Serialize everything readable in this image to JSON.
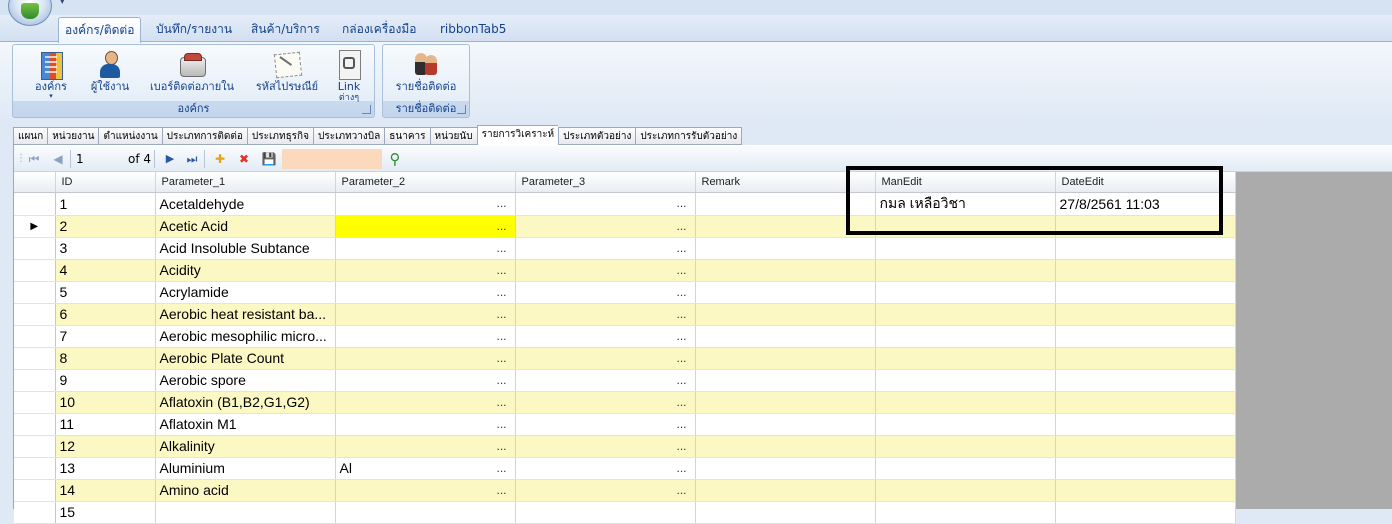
{
  "ribbon": {
    "tabs": [
      "องค์กร/ติดต่อ",
      "บันทึก/รายงาน",
      "สินค้า/บริการ",
      "กล่องเครื่องมือ",
      "ribbonTab5"
    ],
    "group1": {
      "label": "องค์กร",
      "buttons": {
        "org": "องค์กร",
        "user": "ผู้ใช้งาน",
        "phone": "เบอร์ติดต่อภายใน",
        "postcode": "รหัสไปรษณีย์",
        "link": "Link",
        "link_sub": "ต่างๆ"
      }
    },
    "group2": {
      "label": "รายชื่อติดต่อ",
      "buttons": {
        "contacts": "รายชื่อติดต่อ"
      }
    }
  },
  "subtabs": [
    "แผนก",
    "หน่วยงาน",
    "ตำแหน่งงาน",
    "ประเภทการติดต่อ",
    "ประเภทธุรกิจ",
    "ประเภทวางบิล",
    "ธนาคาร",
    "หน่วยนับ",
    "รายการวิเคราะห์",
    "ประเภทตัวอย่าง",
    "ประเภทการรับตัวอย่าง"
  ],
  "navigator": {
    "position": "1",
    "count": "of 4",
    "first": "⏮",
    "prev": "◀",
    "next": "▶",
    "last": "⏭",
    "add": "✚",
    "delete": "✖",
    "save": "💾",
    "search": "⚲"
  },
  "grid": {
    "columns": [
      "ID",
      "Parameter_1",
      "Parameter_2",
      "Parameter_3",
      "Remark",
      "ManEdit",
      "DateEdit"
    ],
    "current_marker": "▶",
    "ellipsis": "...",
    "rows": [
      {
        "id": "1",
        "p1": "Acetaldehyde",
        "p2": "",
        "p3": "",
        "remark": "",
        "man": "กมล เหลือวิชา",
        "date": "27/8/2561 11:03"
      },
      {
        "id": "2",
        "p1": "Acetic Acid",
        "p2": "",
        "p3": "",
        "remark": "",
        "man": "",
        "date": ""
      },
      {
        "id": "3",
        "p1": "Acid Insoluble Subtance",
        "p2": "",
        "p3": "",
        "remark": "",
        "man": "",
        "date": ""
      },
      {
        "id": "4",
        "p1": "Acidity",
        "p2": "",
        "p3": "",
        "remark": "",
        "man": "",
        "date": ""
      },
      {
        "id": "5",
        "p1": "Acrylamide",
        "p2": "",
        "p3": "",
        "remark": "",
        "man": "",
        "date": ""
      },
      {
        "id": "6",
        "p1": "Aerobic heat resistant ba...",
        "p2": "",
        "p3": "",
        "remark": "",
        "man": "",
        "date": ""
      },
      {
        "id": "7",
        "p1": "Aerobic mesophilic micro...",
        "p2": "",
        "p3": "",
        "remark": "",
        "man": "",
        "date": ""
      },
      {
        "id": "8",
        "p1": "Aerobic Plate Count",
        "p2": "",
        "p3": "",
        "remark": "",
        "man": "",
        "date": ""
      },
      {
        "id": "9",
        "p1": "Aerobic spore",
        "p2": "",
        "p3": "",
        "remark": "",
        "man": "",
        "date": ""
      },
      {
        "id": "10",
        "p1": "Aflatoxin (B1,B2,G1,G2)",
        "p2": "",
        "p3": "",
        "remark": "",
        "man": "",
        "date": ""
      },
      {
        "id": "11",
        "p1": "Aflatoxin M1",
        "p2": "",
        "p3": "",
        "remark": "",
        "man": "",
        "date": ""
      },
      {
        "id": "12",
        "p1": "Alkalinity",
        "p2": "",
        "p3": "",
        "remark": "",
        "man": "",
        "date": ""
      },
      {
        "id": "13",
        "p1": "Aluminium",
        "p2": "Al",
        "p3": "",
        "remark": "",
        "man": "",
        "date": ""
      },
      {
        "id": "14",
        "p1": "Amino acid",
        "p2": "",
        "p3": "",
        "remark": "",
        "man": "",
        "date": ""
      },
      {
        "id": "15",
        "p1": "",
        "p2": "",
        "p3": "",
        "remark": "",
        "man": "",
        "date": ""
      }
    ]
  }
}
